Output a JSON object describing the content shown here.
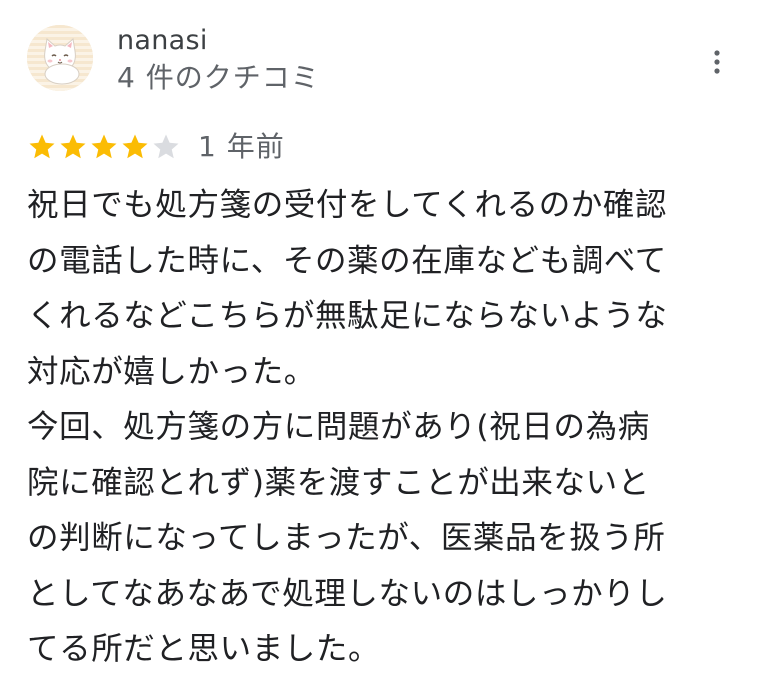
{
  "review": {
    "author": {
      "name": "nanasi",
      "review_count": "4 件のクチコミ",
      "avatar_icon": "cat-avatar-icon"
    },
    "menu_icon": "more-vert-icon",
    "rating": 4,
    "rating_max": 5,
    "star_color": "#fbbc04",
    "star_empty_color": "#dadce0",
    "date": "1 年前",
    "text_lines": [
      "祝日でも処方箋の受付をしてくれるのか確認",
      "の電話した時に、その薬の在庫なども調べて",
      "くれるなどこちらが無駄足にならないような",
      "対応が嬉しかった。",
      "今回、処方箋の方に問題があり(祝日の為病",
      "院に確認とれず)薬を渡すことが出来ないと",
      "の判断になってしまったが、医薬品を扱う所",
      "としてなあなあで処理しないのはしっかりし",
      "てる所だと思いました。"
    ]
  }
}
